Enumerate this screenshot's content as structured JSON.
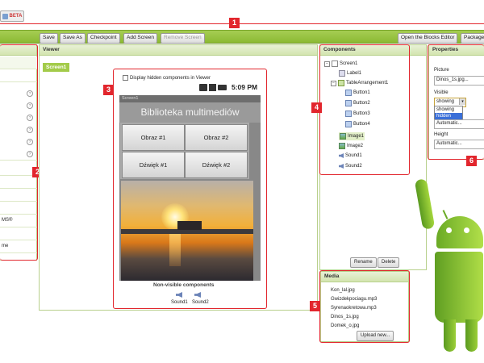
{
  "app": {
    "beta_label": "BETA"
  },
  "toolbar": {
    "save": "Save",
    "save_as": "Save As",
    "checkpoint": "Checkpoint",
    "add_screen": "Add Screen",
    "remove_screen": "Remove Screen",
    "open_blocks": "Open the Blocks Editor",
    "package": "Package"
  },
  "badges": [
    "1",
    "2",
    "3",
    "4",
    "5",
    "6"
  ],
  "palette": {
    "items": [
      "MS®",
      "me"
    ]
  },
  "viewer": {
    "title": "Viewer",
    "screen_tab": "Screen1",
    "checkbox_label": "Display hidden components in Viewer",
    "time": "5:09 PM",
    "screen_title": "Screen1",
    "heading": "Biblioteka multimediów",
    "buttons": [
      "Obraz #1",
      "Obraz #2",
      "Dźwięk #1",
      "Dźwięk #2"
    ],
    "nonvisible_title": "Non-visible components",
    "nonvisible": [
      "Sound1",
      "Sound2"
    ]
  },
  "components": {
    "title": "Components",
    "tree": [
      "Screen1",
      "Label1",
      "TableArrangement1",
      "Button1",
      "Button2",
      "Button3",
      "Button4",
      "Image1",
      "Image2",
      "Sound1",
      "Sound2"
    ],
    "rename": "Rename",
    "delete": "Delete"
  },
  "media": {
    "title": "Media",
    "files": [
      "Kon_lal.jpg",
      "Gwizdekpociagu.mp3",
      "Syrenaokretowa.mp3",
      "Dinos_1s.jpg",
      "Domek_o.jpg"
    ],
    "upload": "Upload new..."
  },
  "properties": {
    "title": "Properties",
    "picture_label": "Picture",
    "picture_value": "Dinos_1s.jpg...",
    "visible_label": "Visible",
    "visible_value": "showing",
    "visible_options": [
      "showing",
      "hidden"
    ],
    "width_value": "Automatic...",
    "height_label": "Height",
    "height_value": "Automatic..."
  }
}
